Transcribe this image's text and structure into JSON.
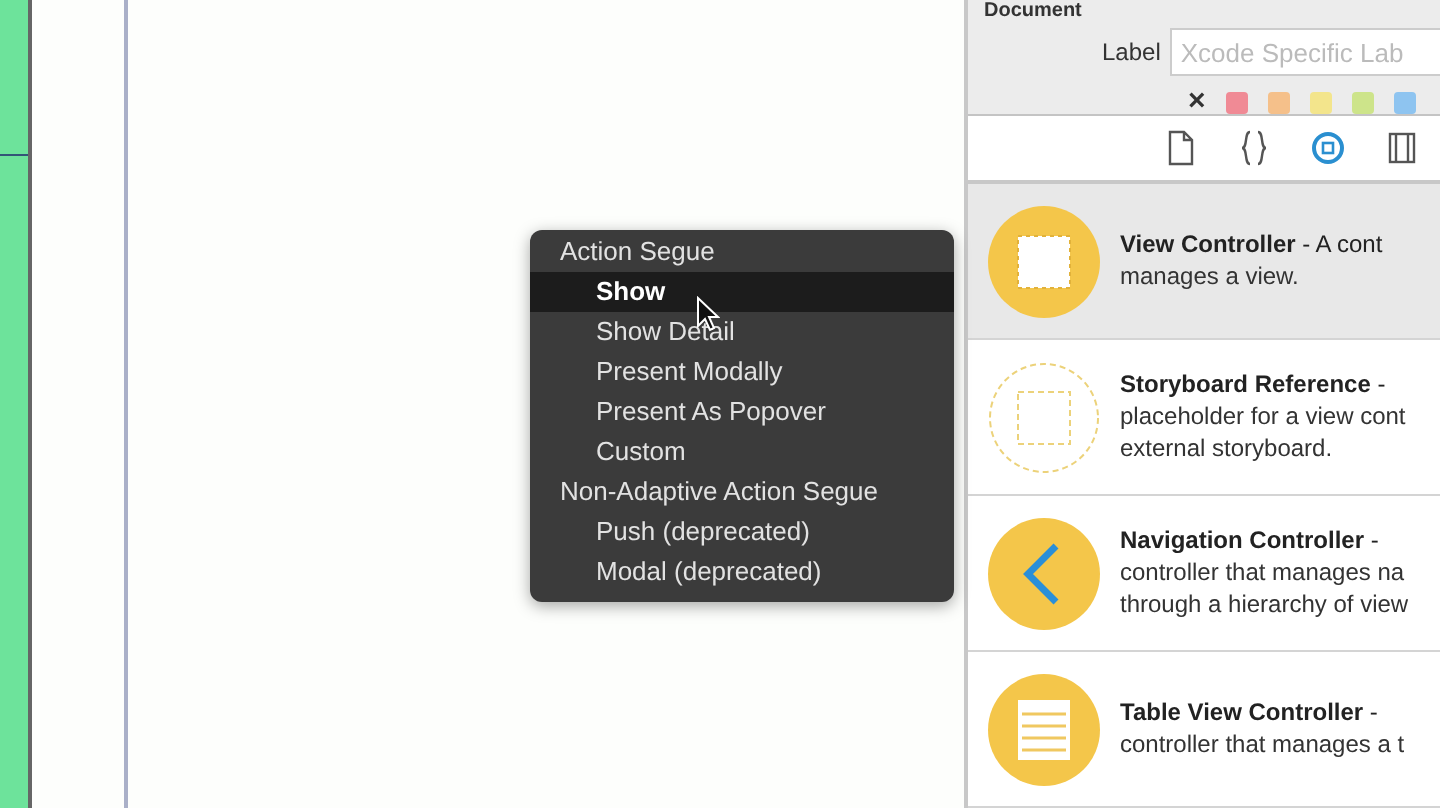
{
  "inspector": {
    "section_title": "Document",
    "label_field": {
      "label": "Label",
      "placeholder": "Xcode Specific Lab"
    },
    "clear_label": "×",
    "label_colors": [
      {
        "color": "#f08a95"
      },
      {
        "color": "#f5c08a"
      },
      {
        "color": "#f3e58c"
      },
      {
        "color": "#cde48a"
      },
      {
        "color": "#8ec4f0"
      }
    ],
    "tabs": [
      {
        "kind": "file",
        "selected": false
      },
      {
        "kind": "braces",
        "selected": false
      },
      {
        "kind": "object",
        "selected": true
      },
      {
        "kind": "media",
        "selected": false
      }
    ]
  },
  "library": [
    {
      "kind": "view",
      "text": "**View Controller** - A cont",
      "detail": [
        "manages a view."
      ],
      "selected": true
    },
    {
      "kind": "reference",
      "text": "**Storyboard Reference** -",
      "detail": [
        "placeholder for a view cont",
        "external storyboard."
      ],
      "selected": false
    },
    {
      "kind": "navigation",
      "text": "**Navigation Controller** -",
      "detail": [
        "controller that manages na",
        "through a hierarchy of view"
      ],
      "selected": false
    },
    {
      "kind": "table",
      "text": "**Table View Controller** -",
      "detail": [
        "controller that manages a t"
      ],
      "selected": false
    }
  ],
  "segue_menu": [
    {
      "kind": "header",
      "label": "Action Segue"
    },
    {
      "kind": "item",
      "label": "Show",
      "selected": true
    },
    {
      "kind": "item",
      "label": "Show Detail",
      "selected": false
    },
    {
      "kind": "item",
      "label": "Present Modally",
      "selected": false
    },
    {
      "kind": "item",
      "label": "Present As Popover",
      "selected": false
    },
    {
      "kind": "item",
      "label": "Custom",
      "selected": false
    },
    {
      "kind": "header",
      "label": "Non-Adaptive Action Segue"
    },
    {
      "kind": "item",
      "label": "Push (deprecated)",
      "selected": false
    },
    {
      "kind": "item",
      "label": "Modal (deprecated)",
      "selected": false
    }
  ]
}
